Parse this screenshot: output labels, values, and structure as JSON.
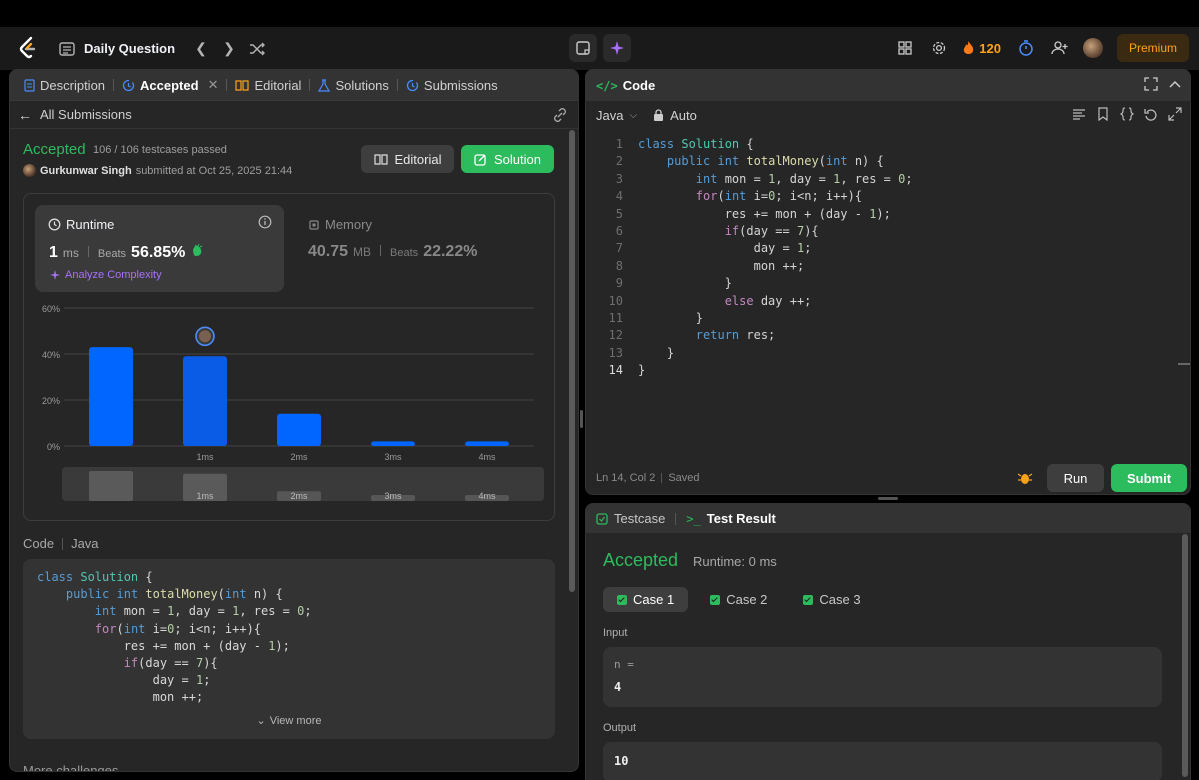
{
  "nav": {
    "title": "Daily Question",
    "streak": "120",
    "premium": "Premium"
  },
  "left": {
    "tabs": [
      "Description",
      "Accepted",
      "Editorial",
      "Solutions",
      "Submissions"
    ],
    "back_label": "All Submissions",
    "status": "Accepted",
    "passed": "106 / 106 testcases passed",
    "author": "Gurkunwar Singh",
    "submitted": "submitted at Oct 25, 2025 21:44",
    "editorial_btn": "Editorial",
    "solution_btn": "Solution",
    "runtime": {
      "label": "Runtime",
      "value": "1",
      "unit": "ms",
      "beats_label": "Beats",
      "beats": "56.85%",
      "analyze": "Analyze Complexity"
    },
    "memory": {
      "label": "Memory",
      "value": "40.75",
      "unit": "MB",
      "beats_label": "Beats",
      "beats": "22.22%"
    },
    "code_label": "Code",
    "code_lang": "Java",
    "view_more": "View more",
    "more_challenges": "More challenges"
  },
  "chart_data": {
    "type": "bar",
    "categories": [
      "",
      "1ms",
      "2ms",
      "3ms",
      "4ms"
    ],
    "values": [
      43,
      39,
      14,
      2,
      2
    ],
    "yticks": [
      "60%",
      "40%",
      "20%",
      "0%"
    ],
    "ylim": [
      0,
      60
    ],
    "highlight_index": 1,
    "bar_color": "#0066ff",
    "grid": true,
    "minimap_labels": [
      "1ms",
      "2ms",
      "3ms",
      "4ms"
    ],
    "minimap_values": [
      43,
      39,
      14,
      2,
      2
    ]
  },
  "code_lines": [
    "class Solution {",
    "    public int totalMoney(int n) {",
    "        int mon = 1, day = 1, res = 0;",
    "        for(int i=0; i<n; i++){",
    "            res += mon + (day - 1);",
    "            if(day == 7){",
    "                day = 1;",
    "                mon ++;",
    "            }",
    "            else day ++;",
    "        }",
    "        return res;",
    "    }",
    "}"
  ],
  "right": {
    "code_tab": "Code",
    "lang": "Java",
    "mode": "Auto",
    "cursor": "Ln 14, Col 2",
    "saved": "Saved",
    "run": "Run",
    "submit": "Submit",
    "testcase_tab": "Testcase",
    "result_tab": "Test Result",
    "result_status": "Accepted",
    "result_runtime": "Runtime: 0 ms",
    "cases": [
      "Case 1",
      "Case 2",
      "Case 3"
    ],
    "input_label": "Input",
    "input_key": "n =",
    "input_val": "4",
    "output_label": "Output",
    "output_val": "10"
  },
  "colors": {
    "accent_green": "#2cbb5d",
    "accent_orange": "#ffa116",
    "bar_blue": "#0066ff"
  }
}
